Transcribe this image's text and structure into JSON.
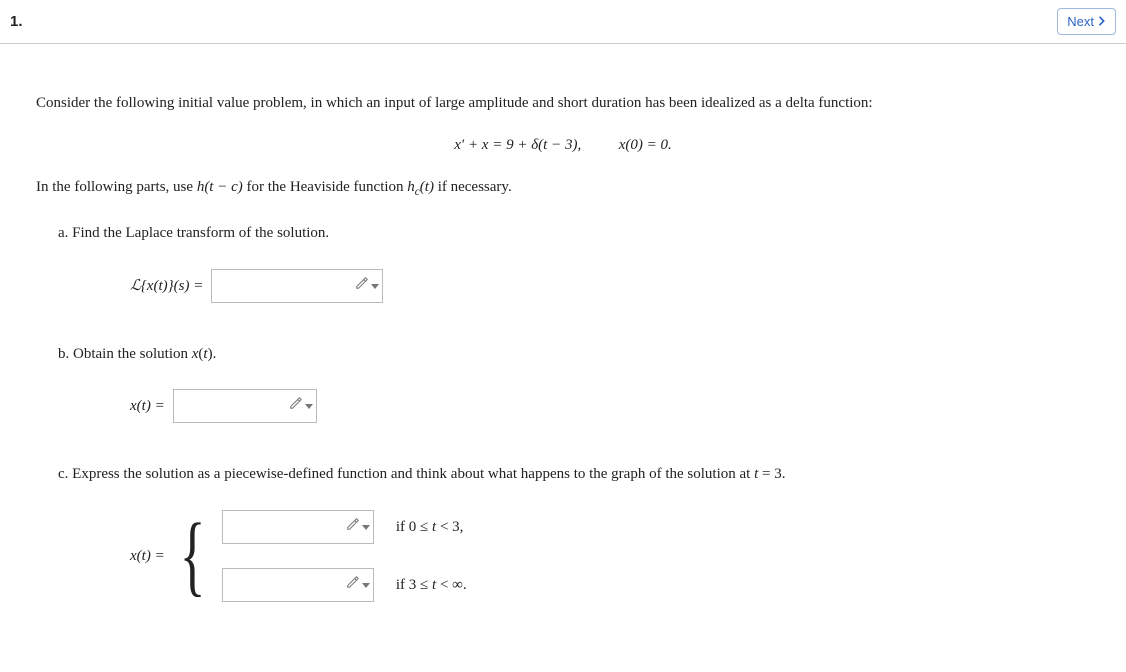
{
  "header": {
    "question_number": "1.",
    "next_label": "Next"
  },
  "problem": {
    "intro": "Consider the following initial value problem, in which an input of large amplitude and short duration has been idealized as a delta function:",
    "equation_lhs": "x′ + x = 9 + δ(t − 3),",
    "equation_rhs": "x(0) = 0.",
    "heaviside_note_pre": "In the following parts, use ",
    "heaviside_h": "h(t − c)",
    "heaviside_note_mid": " for the Heaviside function ",
    "heaviside_hc": "h",
    "heaviside_sub": "c",
    "heaviside_arg": "(t)",
    "heaviside_note_post": " if necessary."
  },
  "parts": {
    "a": {
      "label": "a. Find the Laplace transform of the solution.",
      "lhs": "ℒ{x(t)}(s) ="
    },
    "b": {
      "label": "b. Obtain the solution x(t).",
      "lhs": "x(t) ="
    },
    "c": {
      "label": "c. Express the solution as a piecewise-defined function and think about what happens to the graph of the solution at t = 3.",
      "lhs": "x(t) =",
      "cond1_pre": "if  0 ≤ ",
      "cond1_var": "t",
      "cond1_post": " < 3,",
      "cond2_pre": "if  3 ≤ ",
      "cond2_var": "t",
      "cond2_post": " < ∞."
    }
  },
  "inputs": {
    "a_value": "",
    "b_value": "",
    "c1_value": "",
    "c2_value": ""
  }
}
